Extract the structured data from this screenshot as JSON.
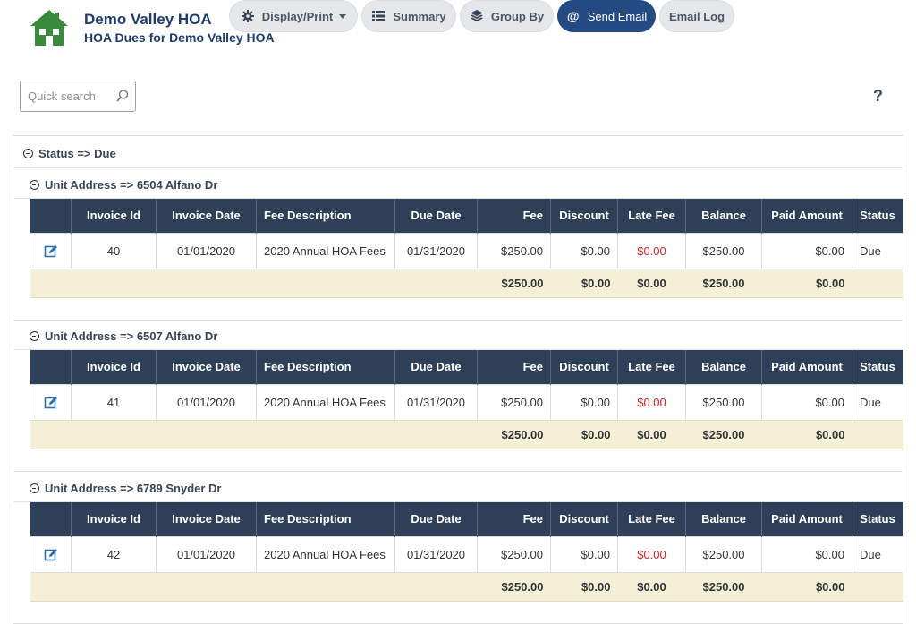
{
  "header": {
    "org_name": "Demo Valley HOA",
    "subtitle": "HOA Dues for Demo Valley HOA",
    "logo_icon": "house-icon",
    "brand_green": "#3a8a3e",
    "brand_navy": "#1f3d6b"
  },
  "search": {
    "placeholder": "Quick search",
    "value": ""
  },
  "toolbar": {
    "display_print": "Display/Print",
    "summary": "Summary",
    "group_by": "Group By",
    "send_email": "Send Email",
    "email_log": "Email Log",
    "help": "?"
  },
  "status_group": {
    "label": "Status => Due"
  },
  "columns": [
    "Invoice Id",
    "Invoice Date",
    "Fee Description",
    "Due Date",
    "Fee",
    "Discount",
    "Late Fee",
    "Balance",
    "Paid Amount",
    "Status"
  ],
  "groups": [
    {
      "label": "Unit Address => 6504 Alfano Dr",
      "rows": [
        {
          "invoice_id": "40",
          "invoice_date": "01/01/2020",
          "fee_description": "2020 Annual HOA Fees",
          "due_date": "01/31/2020",
          "fee": "$250.00",
          "discount": "$0.00",
          "late_fee": "$0.00",
          "balance": "$250.00",
          "paid_amount": "$0.00",
          "status": "Due"
        }
      ],
      "totals": {
        "fee": "$250.00",
        "discount": "$0.00",
        "late_fee": "$0.00",
        "balance": "$250.00",
        "paid_amount": "$0.00"
      }
    },
    {
      "label": "Unit Address => 6507 Alfano Dr",
      "rows": [
        {
          "invoice_id": "41",
          "invoice_date": "01/01/2020",
          "fee_description": "2020 Annual HOA Fees",
          "due_date": "01/31/2020",
          "fee": "$250.00",
          "discount": "$0.00",
          "late_fee": "$0.00",
          "balance": "$250.00",
          "paid_amount": "$0.00",
          "status": "Due"
        }
      ],
      "totals": {
        "fee": "$250.00",
        "discount": "$0.00",
        "late_fee": "$0.00",
        "balance": "$250.00",
        "paid_amount": "$0.00"
      }
    },
    {
      "label": "Unit Address => 6789 Snyder Dr",
      "rows": [
        {
          "invoice_id": "42",
          "invoice_date": "01/01/2020",
          "fee_description": "2020 Annual HOA Fees",
          "due_date": "01/31/2020",
          "fee": "$250.00",
          "discount": "$0.00",
          "late_fee": "$0.00",
          "balance": "$250.00",
          "paid_amount": "$0.00",
          "status": "Due"
        }
      ],
      "totals": {
        "fee": "$250.00",
        "discount": "$0.00",
        "late_fee": "$0.00",
        "balance": "$250.00",
        "paid_amount": "$0.00"
      }
    }
  ],
  "colors": {
    "header_bg": "#2e4057",
    "total_bg": "#f4f0d8",
    "late_fee_red": "#c0282d",
    "primary_button": "#234a82"
  }
}
